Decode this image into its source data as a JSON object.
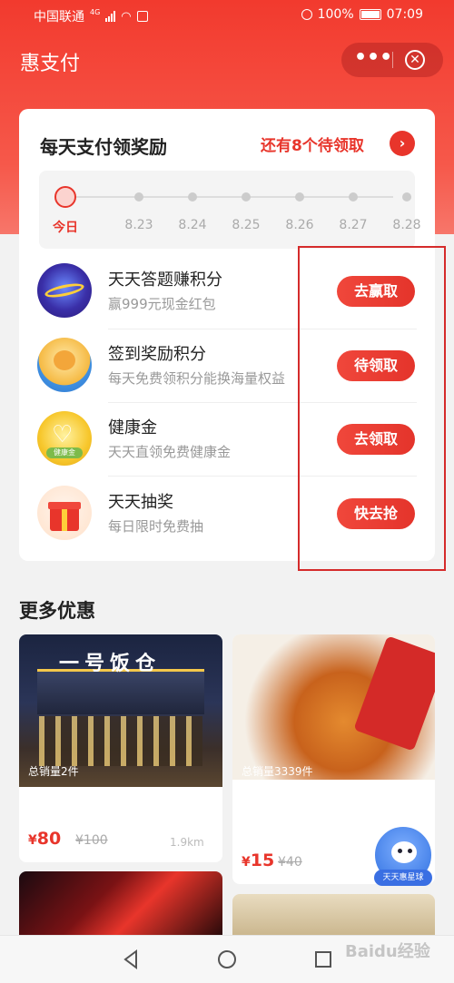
{
  "status_bar": {
    "carrier": "中国联通",
    "network": "4G",
    "battery": "100%",
    "time": "07:09"
  },
  "navbar": {
    "title": "惠支付"
  },
  "reward_card": {
    "title": "每天支付领奖励",
    "pending_text": "还有8个待领取",
    "days": [
      "今日",
      "8.23",
      "8.24",
      "8.25",
      "8.26",
      "8.27",
      "8.28"
    ],
    "tasks": [
      {
        "title": "天天答题赚积分",
        "subtitle": "赢999元现金红包",
        "button": "去赢取",
        "icon": "quiz-planet-icon"
      },
      {
        "title": "签到奖励积分",
        "subtitle": "每天免费领积分能换海量权益",
        "button": "待领取",
        "icon": "bear-signin-icon"
      },
      {
        "title": "健康金",
        "subtitle": "天天直领免费健康金",
        "button": "去领取",
        "icon": "heart-coin-icon",
        "icon_label": "健康金"
      },
      {
        "title": "天天抽奖",
        "subtitle": "每日限时免费抽",
        "button": "快去抢",
        "icon": "gift-box-icon"
      }
    ]
  },
  "more_deals": {
    "title": "更多优惠",
    "items": [
      {
        "sales": "总销量2件",
        "price": "80",
        "original": "100",
        "distance": "1.9km",
        "sign_text": "一号饭仓"
      },
      {
        "sales": "总销量3339件",
        "price": "15",
        "original": "40"
      }
    ]
  },
  "float_ball": {
    "label": "天天惠星球"
  },
  "watermark": "Baidu经验",
  "colors": {
    "primary": "#e8352b",
    "hero": "#f23a2e"
  }
}
